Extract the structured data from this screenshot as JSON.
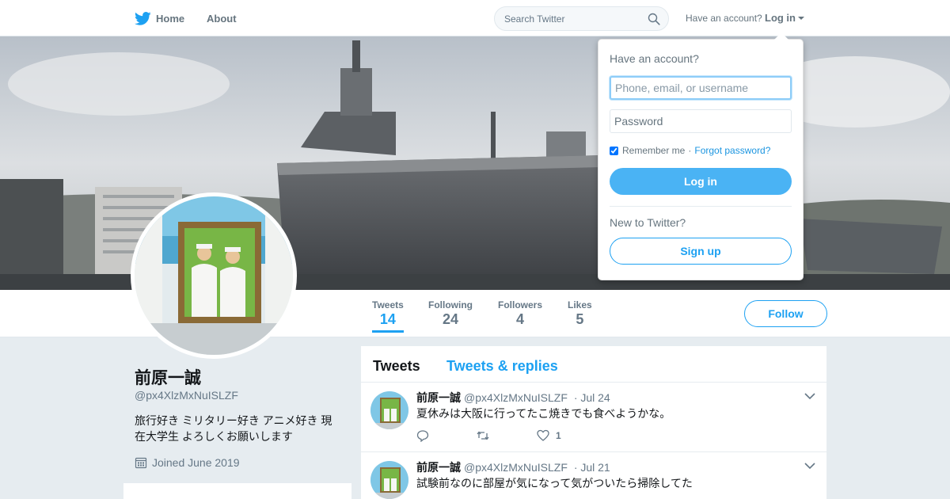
{
  "nav": {
    "home_label": "Home",
    "about_label": "About",
    "search_placeholder": "Search Twitter",
    "have_account_label": "Have an account?",
    "login_label": "Log in"
  },
  "login_dropdown": {
    "title": "Have an account?",
    "username_placeholder": "Phone, email, or username",
    "password_placeholder": "Password",
    "remember_label": "Remember me",
    "separator": "·",
    "forgot_label": "Forgot password?",
    "remember_checked": true,
    "login_button": "Log in",
    "new_label": "New to Twitter?",
    "signup_button": "Sign up"
  },
  "profile": {
    "name": "前原一誠",
    "handle": "@px4XlzMxNuISLZF",
    "bio": "旅行好き ミリタリー好き アニメ好き 現在大学生 よろしくお願いします",
    "joined": "Joined June 2019"
  },
  "stats": [
    {
      "label": "Tweets",
      "value": "14",
      "active": true
    },
    {
      "label": "Following",
      "value": "24",
      "active": false
    },
    {
      "label": "Followers",
      "value": "4",
      "active": false
    },
    {
      "label": "Likes",
      "value": "5",
      "active": false
    }
  ],
  "follow_button": "Follow",
  "timeline": {
    "tabs": [
      "Tweets",
      "Tweets & replies"
    ],
    "tweets": [
      {
        "name": "前原一誠",
        "handle": "@px4XlzMxNuISLZF",
        "date": "· Jul 24",
        "text": "夏休みは大阪に行ってたこ焼きでも食べようかな。",
        "likes": "1"
      },
      {
        "name": "前原一誠",
        "handle": "@px4XlzMxNuISLZF",
        "date": "· Jul 21",
        "text": "試験前なのに部屋が気になって気がついたら掃除してた",
        "likes": ""
      }
    ]
  },
  "colors": {
    "accent": "#1da1f2",
    "login_button": "#4ab3f4",
    "background": "#e6ecf0"
  }
}
